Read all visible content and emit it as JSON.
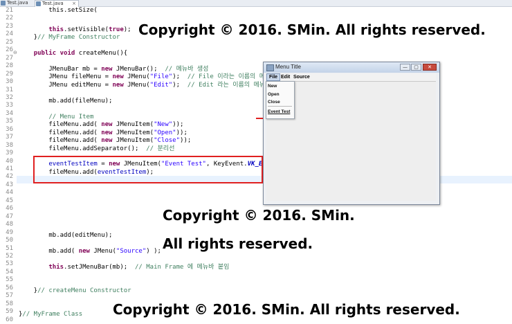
{
  "tabs": [
    {
      "label": "Test.java"
    },
    {
      "label": "Test.java"
    }
  ],
  "editor": {
    "line_numbers": [
      "21",
      "22",
      "23",
      "24",
      "25",
      "26",
      "27",
      "28",
      "29",
      "30",
      "31",
      "32",
      "33",
      "34",
      "35",
      "36",
      "37",
      "38",
      "39",
      "40",
      "41",
      "42",
      "43",
      "44",
      "45",
      "46",
      "47",
      "48",
      "49",
      "50",
      "51",
      "52",
      "53",
      "54",
      "55",
      "56",
      "57",
      "58",
      "59",
      "60"
    ],
    "lines": {
      "l21": "        this.setSize(",
      "l23a": "this",
      "l23b": ".setVisible(",
      "l23c": "true",
      "l23d": ");",
      "l24a": "    }",
      "l24b": "// MyFrame Constructor",
      "l26a": "public",
      "l26b": "void",
      "l26c": " createMenu(){",
      "l28a": "JMenuBar mb = ",
      "l28b": "new",
      "l28c": " JMenuBar();  ",
      "l28d": "// 메뉴바 생성",
      "l29a": "JMenu fileMenu = ",
      "l29b": "new",
      "l29c": " JMenu(",
      "l29d": "\"File\"",
      "l29e": ");  ",
      "l29f": "// File 이라는 이름의 메뉴",
      "l30a": "JMenu editMenu = ",
      "l30b": "new",
      "l30c": " JMenu(",
      "l30d": "\"Edit\"",
      "l30e": ");  ",
      "l30f": "// Edit 라는 이름의 메뉴 생성",
      "l32": "mb.add(fileMenu);",
      "l34": "// Menu Item",
      "l35a": "fileMenu.add( ",
      "l35b": "new",
      "l35c": " JMenuItem(",
      "l35d": "\"New\"",
      "l35e": "));",
      "l36a": "fileMenu.add( ",
      "l36b": "new",
      "l36c": " JMenuItem(",
      "l36d": "\"Open\"",
      "l36e": "));",
      "l37a": "fileMenu.add( ",
      "l37b": "new",
      "l37c": " JMenuItem(",
      "l37d": "\"Close\"",
      "l37e": "));",
      "l38a": "fileMenu.addSeparator();  ",
      "l38b": "// 분리선",
      "l40a": "eventTestItem",
      "l40b": " = ",
      "l40c": "new",
      "l40d": " JMenuItem(",
      "l40e": "\"Event Test\"",
      "l40f": ", KeyEvent.",
      "l40g": "VK_E",
      "l40h": ");",
      "l41a": "fileMenu.add(",
      "l41b": "eventTestItem",
      "l41c": ");",
      "l49": "mb.add(editMenu);",
      "l51a": "mb.add( ",
      "l51b": "new",
      "l51c": " JMenu(",
      "l51d": "\"Source\"",
      "l51e": ") );",
      "l53a": "this",
      "l53b": ".setJMenuBar(mb);  ",
      "l53c": "// Main Frame 에 메뉴바 붙임",
      "l57a": "    }",
      "l57b": "// createMenu Constructor",
      "l59a": "}",
      "l59b": "// MyFrame Class"
    }
  },
  "watermarks": {
    "top": "Copyright © 2016. SMin. All rights reserved.",
    "middle1": "Copyright © 2016. SMin.",
    "middle2": "All rights reserved.",
    "bottom": "Copyright © 2016. SMin. All rights reserved."
  },
  "window": {
    "title": "Menu Title",
    "minimize": "—",
    "maximize": "▢",
    "close": "✕",
    "menus": [
      "File",
      "Edit",
      "Source"
    ],
    "file_items": [
      "New",
      "Open",
      "Close",
      "Event Test"
    ]
  },
  "colors": {
    "highlight_box": "#e02020",
    "keyword": "#7f0055",
    "string": "#2a00ff",
    "comment": "#3f7f5f"
  }
}
